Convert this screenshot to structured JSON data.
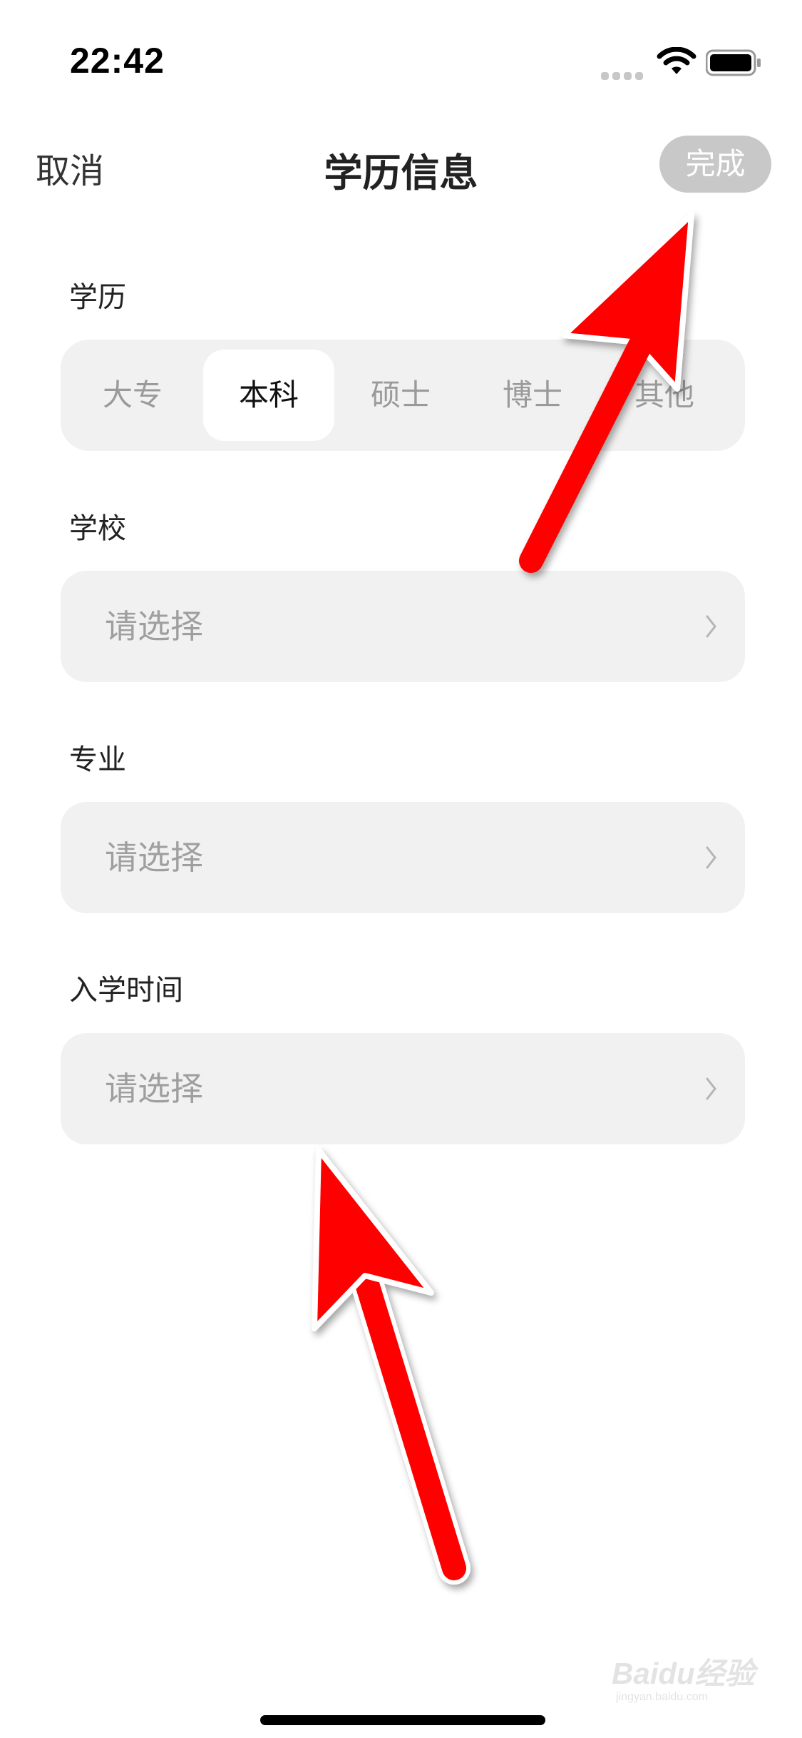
{
  "status_bar": {
    "time": "22:42"
  },
  "nav": {
    "cancel": "取消",
    "title": "学历信息",
    "done": "完成"
  },
  "degree": {
    "label": "学历",
    "options": [
      "大专",
      "本科",
      "硕士",
      "博士",
      "其他"
    ],
    "selected": "本科"
  },
  "school": {
    "label": "学校",
    "placeholder": "请选择"
  },
  "major": {
    "label": "专业",
    "placeholder": "请选择"
  },
  "enrollment": {
    "label": "入学时间",
    "placeholder": "请选择"
  },
  "watermark": {
    "brand": "Baidu经验",
    "url": "jingyan.baidu.com"
  },
  "colors": {
    "annotation_arrow": "#ff0000",
    "field_bg": "#f1f1f1",
    "done_bg": "#c8c8c8"
  }
}
